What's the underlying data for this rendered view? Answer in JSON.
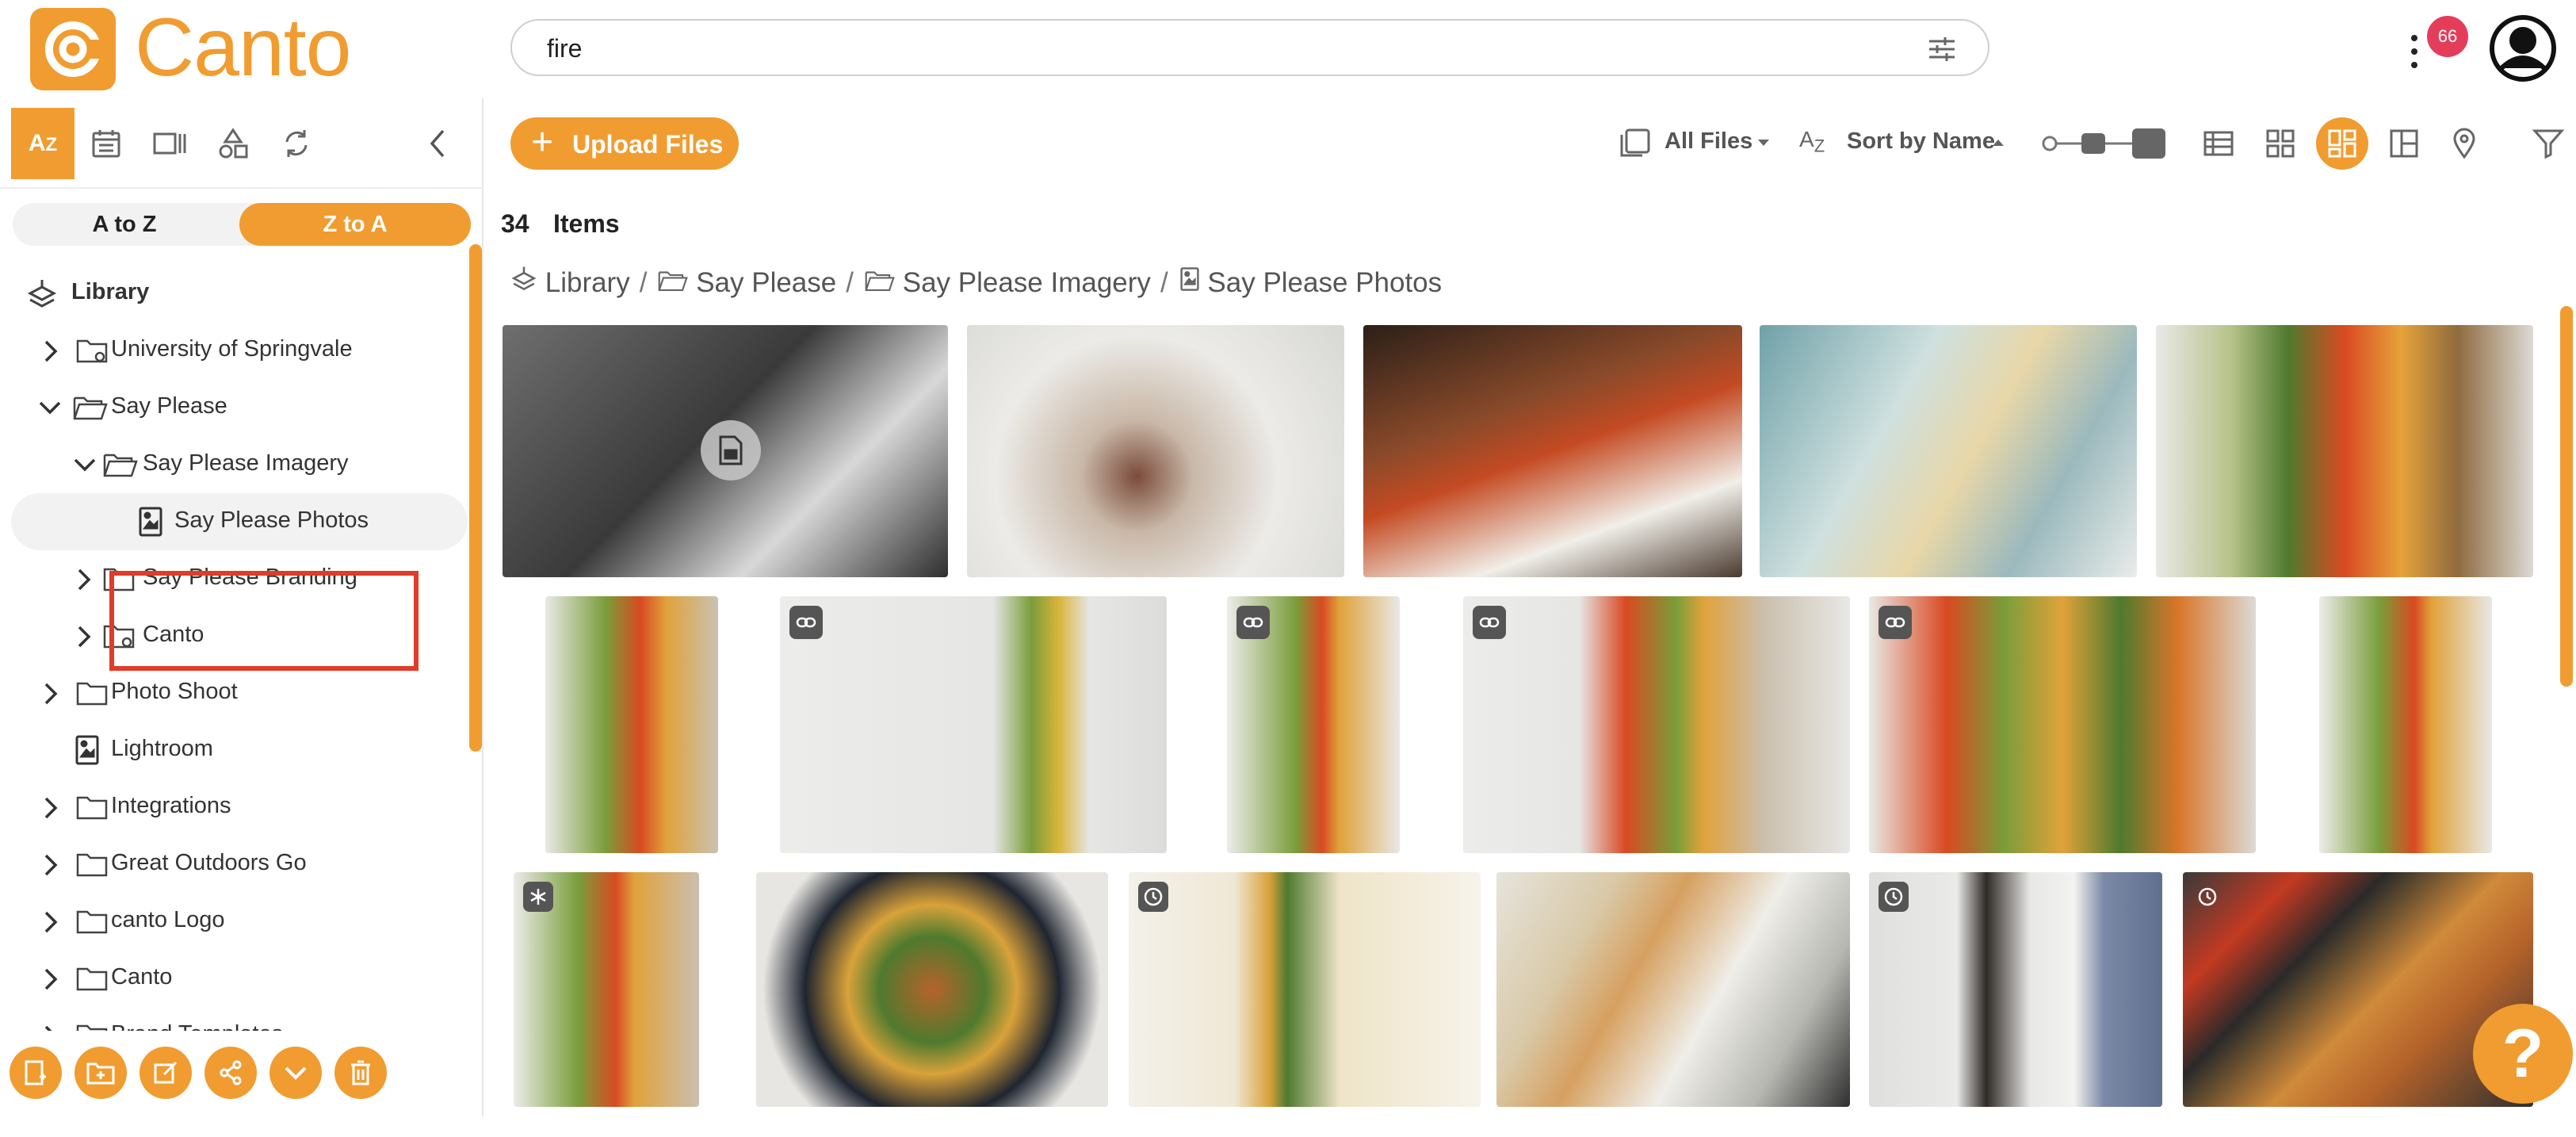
{
  "app": {
    "name": "Canto"
  },
  "search": {
    "value": "fire",
    "placeholder": ""
  },
  "notifications": {
    "count": "66"
  },
  "sidebar": {
    "sort": {
      "asc": "A to Z",
      "desc": "Z to A",
      "active": "desc"
    },
    "tree": [
      {
        "label": "Library",
        "depth": 0,
        "icon": "library-icon"
      },
      {
        "label": "University of Springvale",
        "depth": 1,
        "icon": "folder-icon",
        "expanded": false
      },
      {
        "label": "Say Please",
        "depth": 1,
        "icon": "folder-icon",
        "expanded": true
      },
      {
        "label": "Say Please Imagery",
        "depth": 2,
        "icon": "folder-icon",
        "expanded": true
      },
      {
        "label": "Say Please Photos",
        "depth": 3,
        "icon": "album-icon",
        "selected": true
      },
      {
        "label": "Say Please Branding",
        "depth": 2,
        "icon": "folder-icon",
        "expanded": false
      },
      {
        "label": "Canto",
        "depth": 2,
        "icon": "folder-icon",
        "expanded": false
      },
      {
        "label": "Photo Shoot",
        "depth": 1,
        "icon": "folder-icon",
        "expanded": false
      },
      {
        "label": "Lightroom",
        "depth": 1,
        "icon": "album-icon"
      },
      {
        "label": "Integrations",
        "depth": 1,
        "icon": "folder-icon",
        "expanded": false
      },
      {
        "label": "Great Outdoors Go",
        "depth": 1,
        "icon": "folder-icon",
        "expanded": false
      },
      {
        "label": "canto Logo",
        "depth": 1,
        "icon": "folder-icon",
        "expanded": false
      },
      {
        "label": "Canto",
        "depth": 1,
        "icon": "folder-icon",
        "expanded": false
      },
      {
        "label": "Brand Templates",
        "depth": 1,
        "icon": "folder-icon",
        "expanded": false
      }
    ]
  },
  "toolbar": {
    "upload_label": "Upload Files",
    "all_files_label": "All Files",
    "sort_label": "Sort by Name"
  },
  "content": {
    "count": "34",
    "count_label": "Items",
    "breadcrumb": [
      "Library",
      "Say Please",
      "Say Please Imagery",
      "Say Please Photos"
    ],
    "thumbnails": [
      {
        "subject": "plated fish steaming",
        "badge": "document-icon"
      },
      {
        "subject": "fine dining plate with fig"
      },
      {
        "subject": "grilled steak plate"
      },
      {
        "subject": "phone photographing food"
      },
      {
        "subject": "salad jars"
      },
      {
        "subject": "salad jar"
      },
      {
        "subject": "salad jar on white",
        "badge": "link-icon"
      },
      {
        "subject": "salad jar small",
        "badge": "link-icon"
      },
      {
        "subject": "salad jar on table",
        "badge": "link-icon"
      },
      {
        "subject": "salad jars with cherry tomatoes",
        "badge": "link-icon"
      },
      {
        "subject": "salad jar tall"
      },
      {
        "subject": "salad jar cropped",
        "badge": "snowflake-icon"
      },
      {
        "subject": "grain salad bowl"
      },
      {
        "subject": "pasta on fork",
        "badge": "clock-icon"
      },
      {
        "subject": "spaghetti plate with mussels"
      },
      {
        "subject": "pepper and salt bowl",
        "badge": "clock-icon"
      },
      {
        "subject": "pizza with tomatoes",
        "badge": "clock-icon"
      }
    ]
  },
  "colors": {
    "accent": "#f19c30",
    "alert": "#e43d5a",
    "highlight": "#e03c2a"
  }
}
